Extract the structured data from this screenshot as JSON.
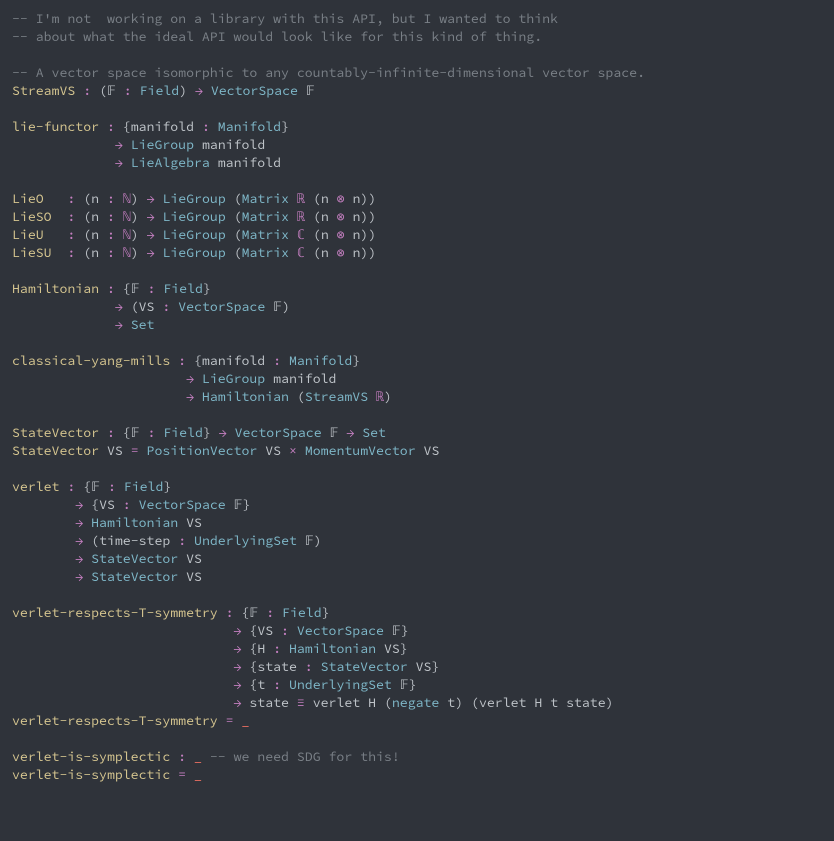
{
  "code": {
    "c1": "-- I'm not  working on a library with this API, but I wanted to think",
    "c2": "-- about what the ideal API would look like for this kind of thing.",
    "c3": "-- A vector space isomorphic to any countably-infinite-dimensional vector space.",
    "streamvs_name": "StreamVS",
    "colon": " : ",
    "lparen": "(",
    "rparen": ")",
    "F": "𝔽",
    "Field": "Field",
    "arrow": " → ",
    "VectorSpace": "VectorSpace",
    "lie_functor": "lie-functor",
    "lbrace": "{",
    "rbrace": "}",
    "manifold": "manifold",
    "Manifold": "Manifold",
    "LieGroup": "LieGroup",
    "LieAlgebra": "LieAlgebra",
    "LieO": "LieO",
    "LieSO": "LieSO",
    "LieU": "LieU",
    "LieSU": "LieSU",
    "n": "n",
    "Nat": "ℕ",
    "Matrix": "Matrix",
    "Real": "ℝ",
    "Complex": "ℂ",
    "tensor": " ⊗ ",
    "Hamiltonian": "Hamiltonian",
    "VS": "VS",
    "Set": "Set",
    "cym": "classical-yang-mills",
    "StateVector": "StateVector",
    "eq": " = ",
    "PositionVector": "PositionVector",
    "times": " × ",
    "MomentumVector": "MomentumVector",
    "verlet": "verlet",
    "time_step": "time-step",
    "UnderlyingSet": "UnderlyingSet",
    "vrts": "verlet-respects-T-symmetry",
    "H": "H",
    "state": "state",
    "t": "t",
    "equiv": " ≡ ",
    "negate": "negate",
    "hole": "_",
    "vis": "verlet-is-symplectic",
    "sdg_comment": " -- we need SDG for this!",
    "sp1": " ",
    "sp_lf_cont": "            ",
    "sp_lie_def": "  ",
    "sp_lie_after": "  ",
    "sp_ham_cont": "            ",
    "sp_cym_cont": "                     ",
    "sp_ver_cont": "       ",
    "sp_vrts_cont": "                           "
  }
}
